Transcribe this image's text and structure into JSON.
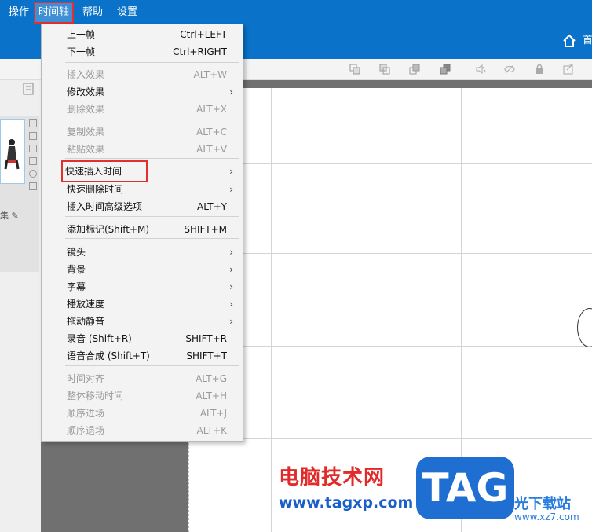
{
  "menubar": {
    "items": [
      {
        "label": "操作"
      },
      {
        "label": "时间轴",
        "active": true
      },
      {
        "label": "帮助"
      },
      {
        "label": "设置"
      }
    ],
    "home_label": "首"
  },
  "thumbnail": {
    "label": "集"
  },
  "dropdown": {
    "items": [
      {
        "label": "上一帧",
        "shortcut": "Ctrl+LEFT",
        "disabled": false
      },
      {
        "label": "下一帧",
        "shortcut": "Ctrl+RIGHT",
        "disabled": false
      },
      {
        "label": "插入效果",
        "shortcut": "ALT+W",
        "disabled": true
      },
      {
        "label": "修改效果",
        "submenu": true,
        "disabled": false
      },
      {
        "label": "删除效果",
        "shortcut": "ALT+X",
        "disabled": true
      },
      {
        "label": "复制效果",
        "shortcut": "ALT+C",
        "disabled": true
      },
      {
        "label": "粘贴效果",
        "shortcut": "ALT+V",
        "disabled": true
      },
      {
        "label": "快速插入时间",
        "submenu": true,
        "disabled": false,
        "highlighted": true
      },
      {
        "label": "快速删除时间",
        "submenu": true,
        "disabled": false
      },
      {
        "label": "插入时间高级选项",
        "shortcut": "ALT+Y",
        "disabled": false
      },
      {
        "label": "添加标记(Shift+M)",
        "shortcut": "SHIFT+M",
        "disabled": false
      },
      {
        "label": "镜头",
        "submenu": true,
        "disabled": false
      },
      {
        "label": "背景",
        "submenu": true,
        "disabled": false
      },
      {
        "label": "字幕",
        "submenu": true,
        "disabled": false
      },
      {
        "label": "播放速度",
        "submenu": true,
        "disabled": false
      },
      {
        "label": "拖动静音",
        "submenu": true,
        "disabled": false
      },
      {
        "label": "录音 (Shift+R)",
        "shortcut": "SHIFT+R",
        "disabled": false
      },
      {
        "label": "语音合成 (Shift+T)",
        "shortcut": "SHIFT+T",
        "disabled": false
      },
      {
        "label": "时间对齐",
        "shortcut": "ALT+G",
        "disabled": true
      },
      {
        "label": "整体移动时间",
        "shortcut": "ALT+H",
        "disabled": true
      },
      {
        "label": "顺序进场",
        "shortcut": "ALT+J",
        "disabled": true
      },
      {
        "label": "顺序退场",
        "shortcut": "ALT+K",
        "disabled": true
      }
    ],
    "submenu_arrow": "›"
  },
  "watermark": {
    "title": "电脑技术网",
    "url": "www.tagxp.com",
    "logo": "TAG",
    "site_name": "光下载站",
    "site_url": "www.xz7.com"
  },
  "colors": {
    "menubar_bg": "#0a73c9",
    "highlight_border": "#e03030",
    "watermark_red": "#e22a2a",
    "watermark_blue": "#1a5fc8"
  },
  "icons": [
    "home-icon",
    "align-icon",
    "lock-icon",
    "mute-icon",
    "copy-icon",
    "delete-icon",
    "star-icon"
  ]
}
